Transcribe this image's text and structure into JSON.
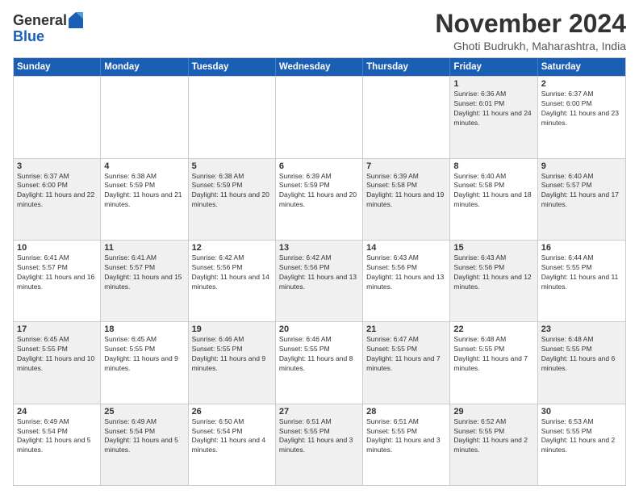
{
  "header": {
    "logo_general": "General",
    "logo_blue": "Blue",
    "month_title": "November 2024",
    "location": "Ghoti Budrukh, Maharashtra, India"
  },
  "calendar": {
    "days_of_week": [
      "Sunday",
      "Monday",
      "Tuesday",
      "Wednesday",
      "Thursday",
      "Friday",
      "Saturday"
    ],
    "weeks": [
      [
        {
          "day": "",
          "info": "",
          "shaded": false
        },
        {
          "day": "",
          "info": "",
          "shaded": false
        },
        {
          "day": "",
          "info": "",
          "shaded": false
        },
        {
          "day": "",
          "info": "",
          "shaded": false
        },
        {
          "day": "",
          "info": "",
          "shaded": false
        },
        {
          "day": "1",
          "info": "Sunrise: 6:36 AM\nSunset: 6:01 PM\nDaylight: 11 hours and 24 minutes.",
          "shaded": true
        },
        {
          "day": "2",
          "info": "Sunrise: 6:37 AM\nSunset: 6:00 PM\nDaylight: 11 hours and 23 minutes.",
          "shaded": false
        }
      ],
      [
        {
          "day": "3",
          "info": "Sunrise: 6:37 AM\nSunset: 6:00 PM\nDaylight: 11 hours and 22 minutes.",
          "shaded": true
        },
        {
          "day": "4",
          "info": "Sunrise: 6:38 AM\nSunset: 5:59 PM\nDaylight: 11 hours and 21 minutes.",
          "shaded": false
        },
        {
          "day": "5",
          "info": "Sunrise: 6:38 AM\nSunset: 5:59 PM\nDaylight: 11 hours and 20 minutes.",
          "shaded": true
        },
        {
          "day": "6",
          "info": "Sunrise: 6:39 AM\nSunset: 5:59 PM\nDaylight: 11 hours and 20 minutes.",
          "shaded": false
        },
        {
          "day": "7",
          "info": "Sunrise: 6:39 AM\nSunset: 5:58 PM\nDaylight: 11 hours and 19 minutes.",
          "shaded": true
        },
        {
          "day": "8",
          "info": "Sunrise: 6:40 AM\nSunset: 5:58 PM\nDaylight: 11 hours and 18 minutes.",
          "shaded": false
        },
        {
          "day": "9",
          "info": "Sunrise: 6:40 AM\nSunset: 5:57 PM\nDaylight: 11 hours and 17 minutes.",
          "shaded": true
        }
      ],
      [
        {
          "day": "10",
          "info": "Sunrise: 6:41 AM\nSunset: 5:57 PM\nDaylight: 11 hours and 16 minutes.",
          "shaded": false
        },
        {
          "day": "11",
          "info": "Sunrise: 6:41 AM\nSunset: 5:57 PM\nDaylight: 11 hours and 15 minutes.",
          "shaded": true
        },
        {
          "day": "12",
          "info": "Sunrise: 6:42 AM\nSunset: 5:56 PM\nDaylight: 11 hours and 14 minutes.",
          "shaded": false
        },
        {
          "day": "13",
          "info": "Sunrise: 6:42 AM\nSunset: 5:56 PM\nDaylight: 11 hours and 13 minutes.",
          "shaded": true
        },
        {
          "day": "14",
          "info": "Sunrise: 6:43 AM\nSunset: 5:56 PM\nDaylight: 11 hours and 13 minutes.",
          "shaded": false
        },
        {
          "day": "15",
          "info": "Sunrise: 6:43 AM\nSunset: 5:56 PM\nDaylight: 11 hours and 12 minutes.",
          "shaded": true
        },
        {
          "day": "16",
          "info": "Sunrise: 6:44 AM\nSunset: 5:55 PM\nDaylight: 11 hours and 11 minutes.",
          "shaded": false
        }
      ],
      [
        {
          "day": "17",
          "info": "Sunrise: 6:45 AM\nSunset: 5:55 PM\nDaylight: 11 hours and 10 minutes.",
          "shaded": true
        },
        {
          "day": "18",
          "info": "Sunrise: 6:45 AM\nSunset: 5:55 PM\nDaylight: 11 hours and 9 minutes.",
          "shaded": false
        },
        {
          "day": "19",
          "info": "Sunrise: 6:46 AM\nSunset: 5:55 PM\nDaylight: 11 hours and 9 minutes.",
          "shaded": true
        },
        {
          "day": "20",
          "info": "Sunrise: 6:46 AM\nSunset: 5:55 PM\nDaylight: 11 hours and 8 minutes.",
          "shaded": false
        },
        {
          "day": "21",
          "info": "Sunrise: 6:47 AM\nSunset: 5:55 PM\nDaylight: 11 hours and 7 minutes.",
          "shaded": true
        },
        {
          "day": "22",
          "info": "Sunrise: 6:48 AM\nSunset: 5:55 PM\nDaylight: 11 hours and 7 minutes.",
          "shaded": false
        },
        {
          "day": "23",
          "info": "Sunrise: 6:48 AM\nSunset: 5:55 PM\nDaylight: 11 hours and 6 minutes.",
          "shaded": true
        }
      ],
      [
        {
          "day": "24",
          "info": "Sunrise: 6:49 AM\nSunset: 5:54 PM\nDaylight: 11 hours and 5 minutes.",
          "shaded": false
        },
        {
          "day": "25",
          "info": "Sunrise: 6:49 AM\nSunset: 5:54 PM\nDaylight: 11 hours and 5 minutes.",
          "shaded": true
        },
        {
          "day": "26",
          "info": "Sunrise: 6:50 AM\nSunset: 5:54 PM\nDaylight: 11 hours and 4 minutes.",
          "shaded": false
        },
        {
          "day": "27",
          "info": "Sunrise: 6:51 AM\nSunset: 5:55 PM\nDaylight: 11 hours and 3 minutes.",
          "shaded": true
        },
        {
          "day": "28",
          "info": "Sunrise: 6:51 AM\nSunset: 5:55 PM\nDaylight: 11 hours and 3 minutes.",
          "shaded": false
        },
        {
          "day": "29",
          "info": "Sunrise: 6:52 AM\nSunset: 5:55 PM\nDaylight: 11 hours and 2 minutes.",
          "shaded": true
        },
        {
          "day": "30",
          "info": "Sunrise: 6:53 AM\nSunset: 5:55 PM\nDaylight: 11 hours and 2 minutes.",
          "shaded": false
        }
      ]
    ]
  }
}
